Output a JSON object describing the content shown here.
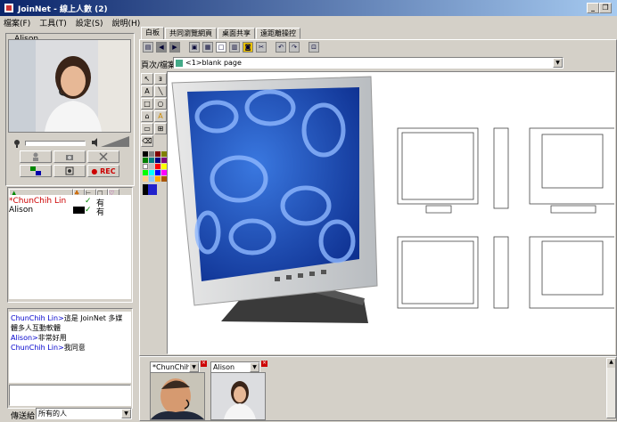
{
  "window": {
    "title": "JoinNet - 線上人數 (2)"
  },
  "menu": [
    "檔案(F)",
    "工具(T)",
    "設定(S)",
    "說明(H)"
  ],
  "left": {
    "video_caption": "Alison",
    "rec_label": "● REC",
    "participants": [
      {
        "name": "*ChunChih Lin",
        "status": "有"
      },
      {
        "name": "Alison",
        "status": "有"
      }
    ],
    "chat": [
      {
        "who": "ChunChih Lin>",
        "msg": "這是 JoinNet 多媒體多人互動軟體"
      },
      {
        "who": "Alison>",
        "msg": "非常好用"
      },
      {
        "who": "ChunChih Lin>",
        "msg": "我同意"
      }
    ],
    "send_label": "傳送給",
    "send_target": "所有的人"
  },
  "tabs": [
    "白板",
    "共同瀏覽網頁",
    "桌面共享",
    "遠距離操控"
  ],
  "page_selector": {
    "label": "頁次/檔案",
    "value": "<1>blank page"
  },
  "bottom": {
    "thumb1": "*ChunChih l",
    "thumb2": "Alison"
  },
  "colors": {
    "title_start": "#0a246a",
    "title_end": "#a6caf0",
    "link": "#0000cc"
  }
}
